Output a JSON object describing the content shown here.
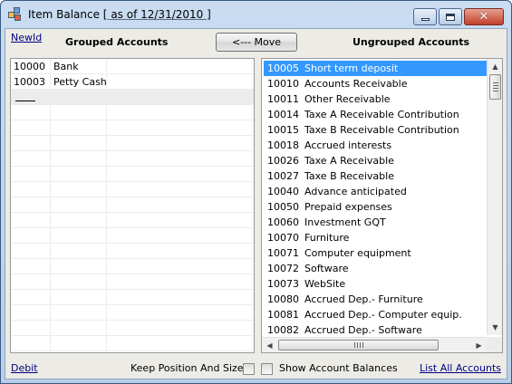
{
  "window": {
    "title_prefix": "Item Balance [",
    "title_date": " as of 12/31/2010 ",
    "title_suffix": "]",
    "buttons": {
      "minimize": "minimize",
      "maximize": "maximize",
      "close": "✕"
    }
  },
  "toolbar": {
    "newid_label": "NewId",
    "grouped_header": "Grouped Accounts",
    "move_label": "<--- Move",
    "ungrouped_header": "Ungrouped Accounts"
  },
  "grouped_accounts": [
    {
      "code": "10000",
      "name": "Bank"
    },
    {
      "code": "10003",
      "name": "Petty Cash"
    }
  ],
  "ungrouped_accounts": [
    {
      "code": "10005",
      "name": "Short term deposit",
      "selected": true
    },
    {
      "code": "10010",
      "name": "Accounts Receivable"
    },
    {
      "code": "10011",
      "name": "Other Receivable"
    },
    {
      "code": "10014",
      "name": "Taxe A Receivable Contribution"
    },
    {
      "code": "10015",
      "name": "Taxe B Receivable Contribution"
    },
    {
      "code": "10018",
      "name": "Accrued interests"
    },
    {
      "code": "10026",
      "name": "Taxe A Receivable"
    },
    {
      "code": "10027",
      "name": "Taxe B Receivable"
    },
    {
      "code": "10040",
      "name": "Advance anticipated"
    },
    {
      "code": "10050",
      "name": "Prepaid expenses"
    },
    {
      "code": "10060",
      "name": "Investment GQT"
    },
    {
      "code": "10070",
      "name": "Furniture"
    },
    {
      "code": "10071",
      "name": "Computer equipment"
    },
    {
      "code": "10072",
      "name": "Software"
    },
    {
      "code": "10073",
      "name": "WebSite"
    },
    {
      "code": "10080",
      "name": "Accrued Dep.- Furniture"
    },
    {
      "code": "10081",
      "name": "Accrued Dep.- Computer equip."
    },
    {
      "code": "10082",
      "name": "Accrued Dep.- Software"
    }
  ],
  "footer": {
    "debit_label": "Debit",
    "keep_label": "Keep Position And Size",
    "keep_checked": false,
    "show_label": "Show Account Balances",
    "show_checked": false,
    "list_all_label": "List All Accounts"
  },
  "colors": {
    "selection": "#3399ff",
    "link": "#000080",
    "client_bg": "#ecebe5"
  }
}
